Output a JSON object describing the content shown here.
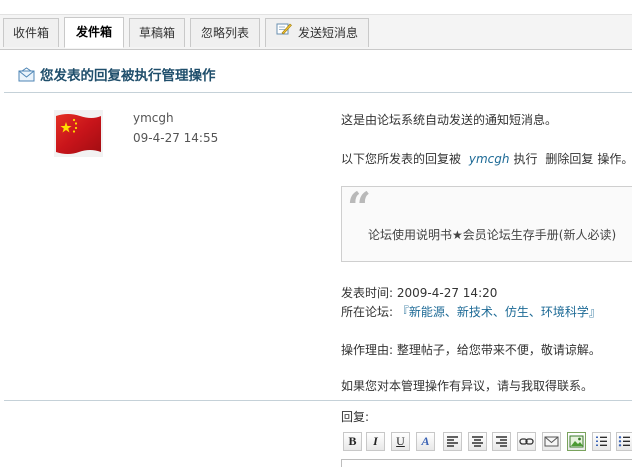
{
  "tabs": [
    {
      "label": "收件箱"
    },
    {
      "label": "发件箱"
    },
    {
      "label": "草稿箱"
    },
    {
      "label": "忽略列表"
    },
    {
      "label": "发送短消息"
    }
  ],
  "page_title": "您发表的回复被执行管理操作",
  "sender": {
    "name": "ymcgh",
    "date": "09-4-27 14:55",
    "avatar": "china-flag-avatar"
  },
  "message": {
    "line1": "这是由论坛系统自动发送的通知短消息。",
    "line2_prefix": "以下您所发表的回复被",
    "line2_user": "ymcgh",
    "line2_action": "执行",
    "line2_op": "删除回复",
    "line2_suffix": "操作。",
    "quote_text": "论坛使用说明书★会员论坛生存手册(新人必读)",
    "post_time_label": "发表时间:",
    "post_time": "2009-4-27 14:20",
    "forum_label": "所在论坛:",
    "forum_name": "『新能源、新技术、仿生、环境科学』",
    "reason_label": "操作理由:",
    "reason": "整理帖子，给您带来不便，敬请谅解。",
    "closing": "如果您对本管理操作有异议，请与我取得联系。"
  },
  "reply": {
    "label": "回复:"
  },
  "toolbar": {
    "bold": "B",
    "italic": "I",
    "underline": "U",
    "font_color": "A"
  }
}
